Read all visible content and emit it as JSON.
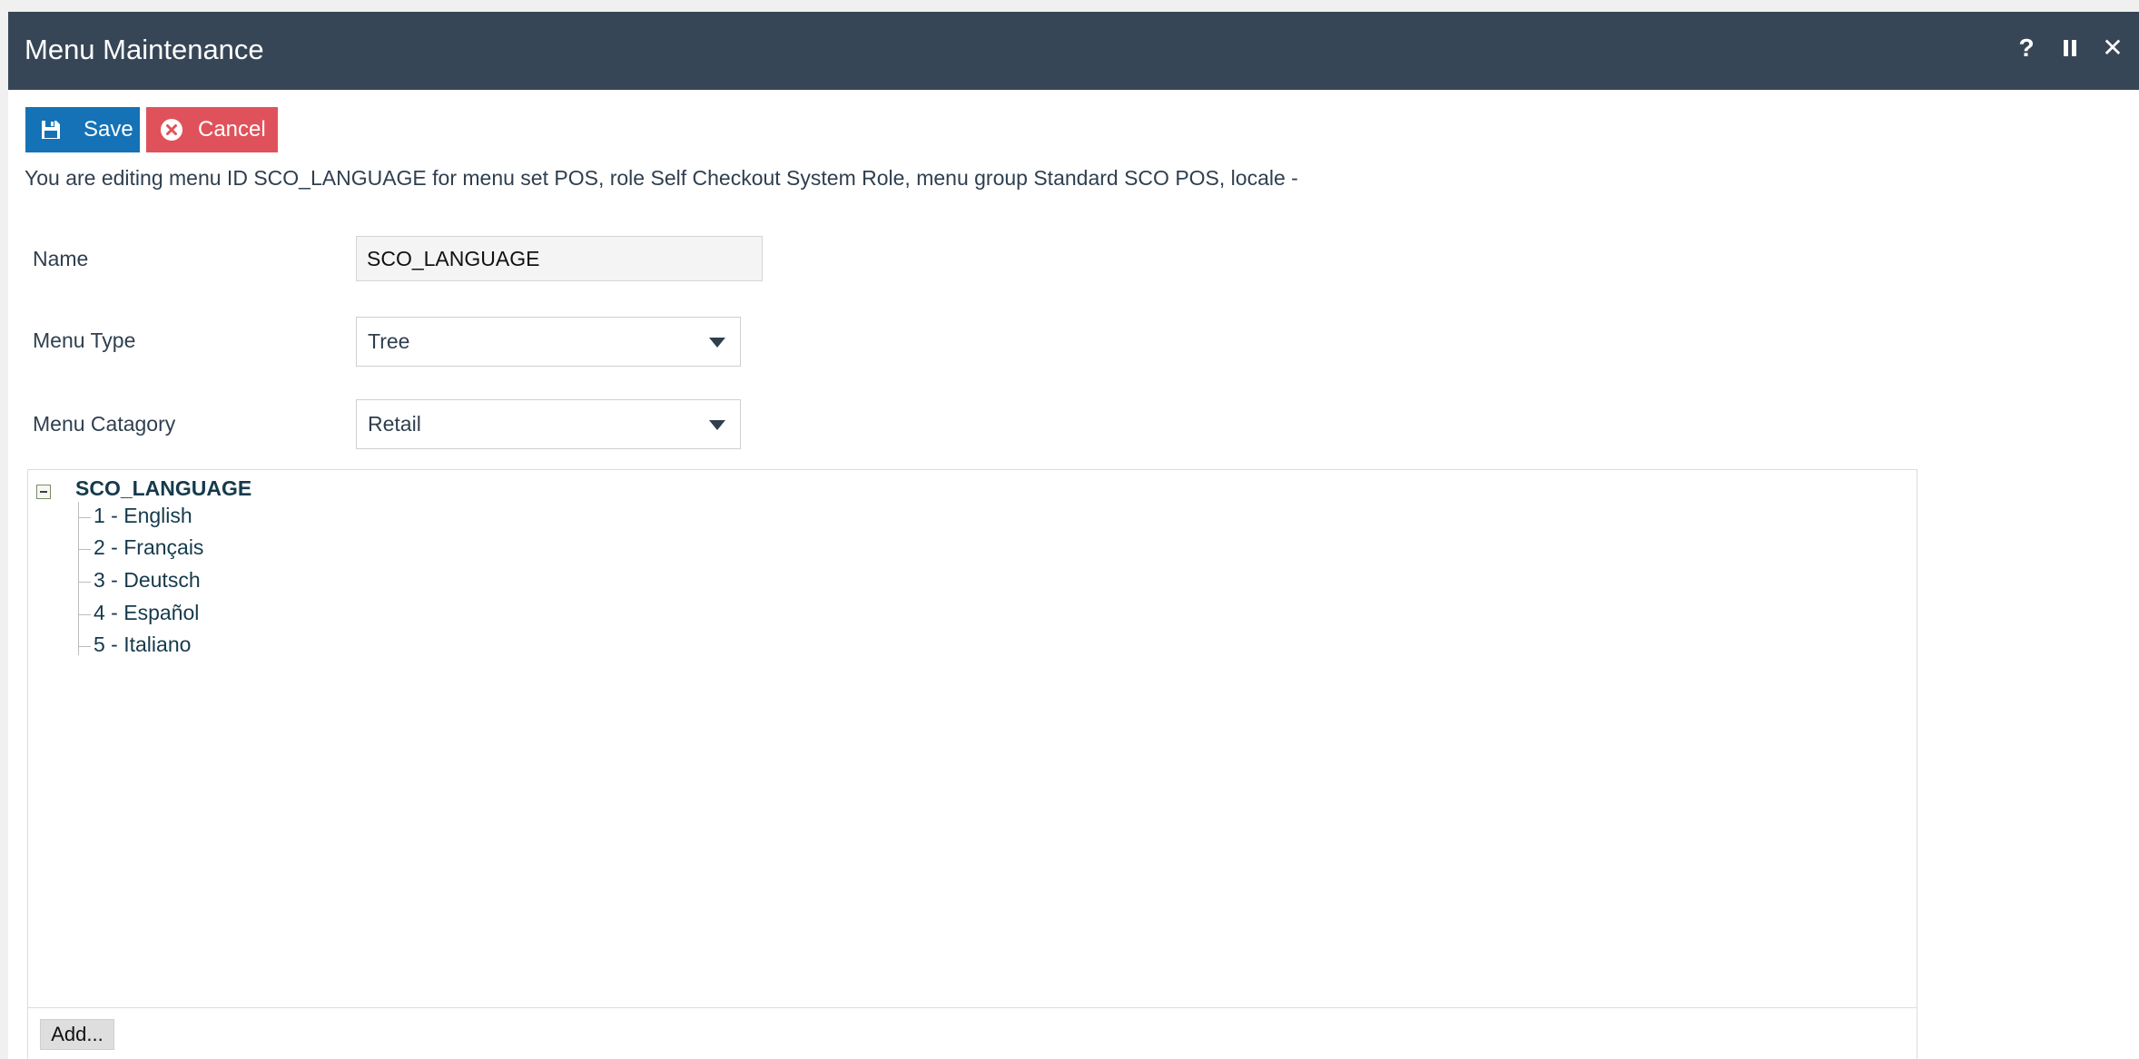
{
  "window": {
    "title": "Menu Maintenance",
    "controls": {
      "help": "?",
      "close": "✕"
    }
  },
  "toolbar": {
    "save_label": "Save",
    "cancel_label": "Cancel"
  },
  "info_text": "You are editing menu ID SCO_LANGUAGE for menu set POS, role Self Checkout System Role, menu group Standard SCO POS, locale -",
  "form": {
    "name_label": "Name",
    "name_value": "SCO_LANGUAGE",
    "menu_type_label": "Menu Type",
    "menu_type_value": "Tree",
    "menu_category_label": "Menu Catagory",
    "menu_category_value": "Retail"
  },
  "tree": {
    "root": "SCO_LANGUAGE",
    "items": [
      "1 - English",
      "2 - Français",
      "3 - Deutsch",
      "4 - Español",
      "5 - Italiano"
    ],
    "add_label": "Add..."
  },
  "colors": {
    "titlebar": "#374656",
    "save": "#1572b6",
    "cancel": "#e0525b"
  }
}
